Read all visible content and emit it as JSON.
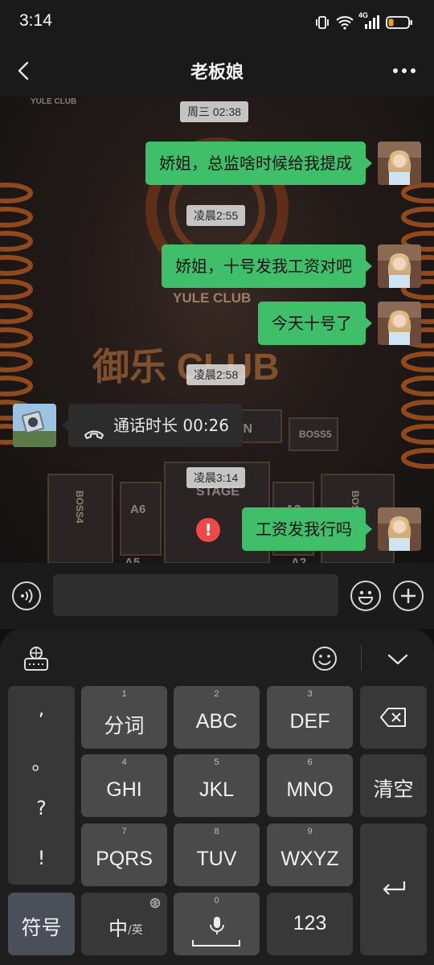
{
  "status_bar": {
    "time": "3:14",
    "network": "4G"
  },
  "header": {
    "title": "老板娘"
  },
  "messages": {
    "t1": "周三 02:38",
    "m1": "娇姐，总监啥时候给我提成",
    "t2": "凌晨2:55",
    "m2": "娇姐，十号发我工资对吧",
    "m3": "今天十号了",
    "t3": "凌晨2:58",
    "call_label": "通话时长 00:26",
    "t4": "凌晨3:14",
    "m4": "工资发我行吗",
    "fail_mark": "!"
  },
  "background_text": {
    "yule_top": "YULE CLUB",
    "yule_mid": "YULE CLUB",
    "brand": "御乐 CLUB",
    "on": "ON",
    "boss5": "BOSS5",
    "boss4": "BOSS4",
    "boss3": "BOSS3",
    "stage": "STAGE",
    "a6": "A6",
    "a3": "A3",
    "a5": "A5",
    "a2": "A2"
  },
  "input": {
    "value": ""
  },
  "keyboard": {
    "punct": [
      ",",
      "。",
      "?",
      "!"
    ],
    "keys": {
      "k1": {
        "num": "1",
        "label": "分词"
      },
      "k2": {
        "num": "2",
        "label": "ABC"
      },
      "k3": {
        "num": "3",
        "label": "DEF"
      },
      "k4": {
        "num": "4",
        "label": "GHI"
      },
      "k5": {
        "num": "5",
        "label": "JKL"
      },
      "k6": {
        "num": "6",
        "label": "MNO"
      },
      "k7": {
        "num": "7",
        "label": "PQRS"
      },
      "k8": {
        "num": "8",
        "label": "TUV"
      },
      "k9": {
        "num": "9",
        "label": "WXYZ"
      },
      "k0": {
        "num": "0"
      }
    },
    "symbol": "符号",
    "lang_main": "中",
    "lang_sub": "/英",
    "clear": "清空",
    "num123": "123"
  },
  "icons": {
    "back": "chevron-left-icon",
    "more": "more-dots-icon",
    "voice": "voice-icon",
    "emoji": "emoji-icon",
    "plus": "plus-icon",
    "globe": "globe-keyboard-icon",
    "smile": "smile-icon",
    "collapse": "chevron-down-icon",
    "backspace": "backspace-icon",
    "enter": "enter-icon",
    "mic": "mic-icon"
  },
  "colors": {
    "my_bubble": "#3fbf6a",
    "error": "#f04848"
  }
}
